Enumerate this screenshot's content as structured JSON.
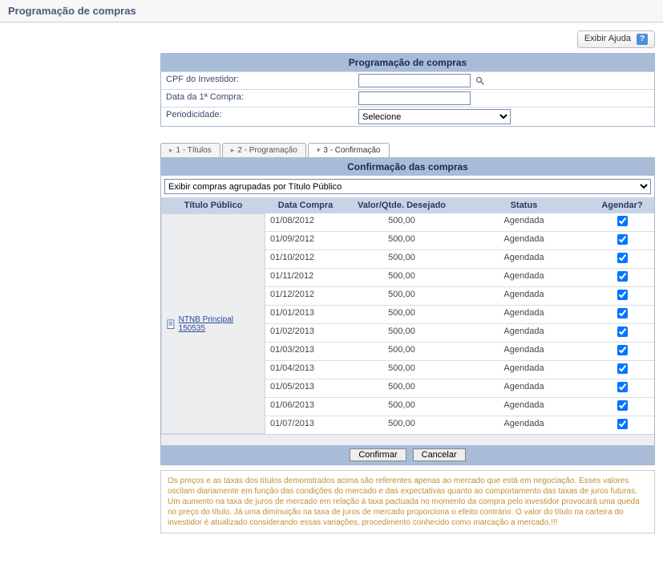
{
  "page_title": "Programação de compras",
  "help": {
    "label": "Exibir Ajuda",
    "icon_text": "?"
  },
  "panel1": {
    "title": "Programação de compras",
    "cpf_label": "CPF do Investidor:",
    "cpf_value": "",
    "data1_label": "Data da 1ª Compra:",
    "data1_value": "",
    "period_label": "Periodicidade:",
    "period_selected": "Selecione"
  },
  "tabs": {
    "t1": "1 - Títulos",
    "t2": "2 - Programação",
    "t3": "3 - Confirmação"
  },
  "panel2": {
    "title": "Confirmação das compras",
    "group_select": "Exibir compras agrupadas por Título Público",
    "col_titulo": "Título Público",
    "col_data": "Data Compra",
    "col_valor": "Valor/Qtde. Desejado",
    "col_status": "Status",
    "col_agendar": "Agendar?",
    "group_link": "NTNB Principal 150535",
    "rows": [
      {
        "data": "01/08/2012",
        "valor": "500,00",
        "status": "Agendada",
        "checked": true
      },
      {
        "data": "01/09/2012",
        "valor": "500,00",
        "status": "Agendada",
        "checked": true
      },
      {
        "data": "01/10/2012",
        "valor": "500,00",
        "status": "Agendada",
        "checked": true
      },
      {
        "data": "01/11/2012",
        "valor": "500,00",
        "status": "Agendada",
        "checked": true
      },
      {
        "data": "01/12/2012",
        "valor": "500,00",
        "status": "Agendada",
        "checked": true
      },
      {
        "data": "01/01/2013",
        "valor": "500,00",
        "status": "Agendada",
        "checked": true
      },
      {
        "data": "01/02/2013",
        "valor": "500,00",
        "status": "Agendada",
        "checked": true
      },
      {
        "data": "01/03/2013",
        "valor": "500,00",
        "status": "Agendada",
        "checked": true
      },
      {
        "data": "01/04/2013",
        "valor": "500,00",
        "status": "Agendada",
        "checked": true
      },
      {
        "data": "01/05/2013",
        "valor": "500,00",
        "status": "Agendada",
        "checked": true
      },
      {
        "data": "01/06/2013",
        "valor": "500,00",
        "status": "Agendada",
        "checked": true
      },
      {
        "data": "01/07/2013",
        "valor": "500,00",
        "status": "Agendada",
        "checked": true
      }
    ],
    "confirm": "Confirmar",
    "cancel": "Cancelar"
  },
  "disclaimer": "Os preços e as taxas dos títulos demonstrados acima são referentes apenas ao mercado que está em negociação. Esses valores oscilam diariamente em função das condições do mercado e das expectativas quanto ao comportamento das taxas de juros futuras. Um aumento na taxa de juros de mercado em relação à taxa pactuada no momento da compra pelo investidor provocará uma queda no preço do título. Já uma diminuição na taxa de juros de mercado proporciona o efeito contrário. O valor do título na carteira do investidor é atualizado considerando essas variações, procedimento conhecido como marcação a mercado.!!!"
}
